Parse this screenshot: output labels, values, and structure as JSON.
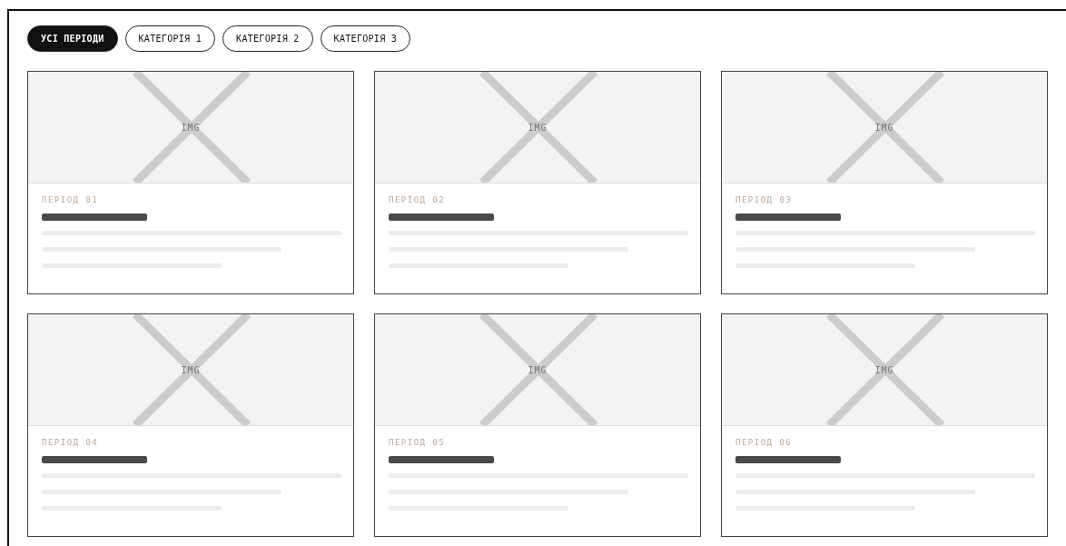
{
  "filters": [
    {
      "label": "УСІ ПЕРІОДИ",
      "selected": true
    },
    {
      "label": "КАТЕГОРІЯ 1",
      "selected": false
    },
    {
      "label": "КАТЕГОРІЯ 2",
      "selected": false
    },
    {
      "label": "КАТЕГОРІЯ 3",
      "selected": false
    }
  ],
  "cards": [
    {
      "image_label": "IMG",
      "period": "ПЕРІОД 01"
    },
    {
      "image_label": "IMG",
      "period": "ПЕРІОД 02"
    },
    {
      "image_label": "IMG",
      "period": "ПЕРІОД 03"
    },
    {
      "image_label": "IMG",
      "period": "ПЕРІОД 04"
    },
    {
      "image_label": "IMG",
      "period": "ПЕРІОД 05"
    },
    {
      "image_label": "IMG",
      "period": "ПЕРІОД 06"
    }
  ]
}
